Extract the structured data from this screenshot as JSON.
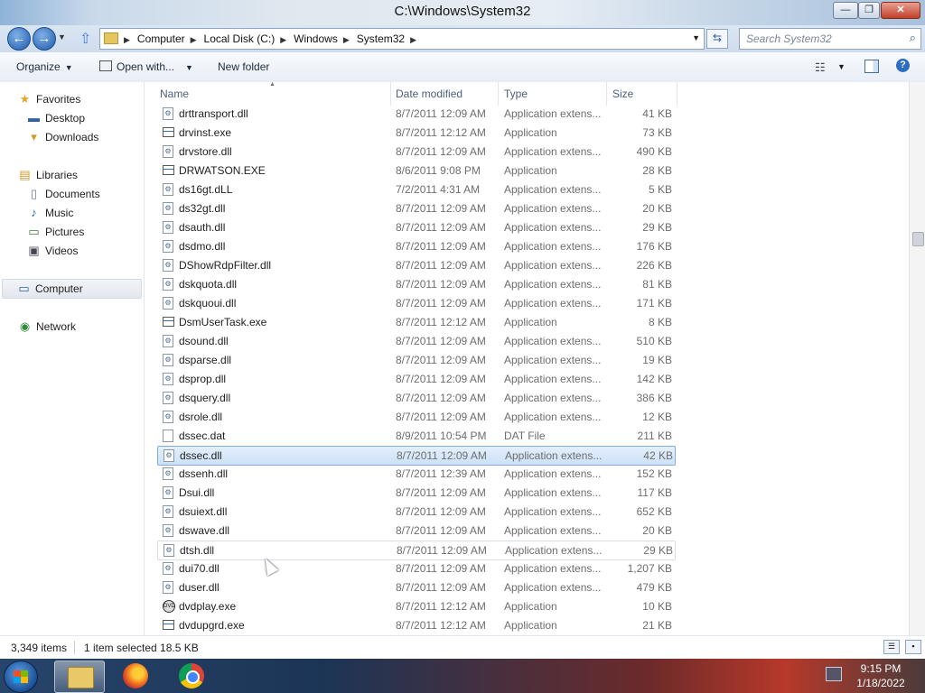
{
  "window": {
    "title": "C:\\Windows\\System32",
    "minimize_label": "—",
    "maximize_label": "❐",
    "close_label": "✕"
  },
  "address_bar": {
    "crumbs": [
      "Computer",
      "Local Disk (C:)",
      "Windows",
      "System32"
    ],
    "separator": "▶",
    "back_icon": "←",
    "forward_icon": "→",
    "refresh_icon": "⇆"
  },
  "search": {
    "placeholder": "Search System32",
    "icon": "⌕"
  },
  "commands": {
    "organize": "Organize",
    "open_with": "Open with...",
    "new_folder": "New folder",
    "caret": "▼",
    "help": "?"
  },
  "nav_pane": {
    "favorites": {
      "label": "Favorites",
      "icon": "★"
    },
    "desktop": {
      "label": "Desktop",
      "icon": "▬"
    },
    "downloads": {
      "label": "Downloads",
      "icon": "▾"
    },
    "libraries": {
      "label": "Libraries",
      "icon": "▤"
    },
    "documents": {
      "label": "Documents",
      "icon": "▯"
    },
    "music": {
      "label": "Music",
      "icon": "♪"
    },
    "pictures": {
      "label": "Pictures",
      "icon": "▭"
    },
    "videos": {
      "label": "Videos",
      "icon": "▣"
    },
    "computer": {
      "label": "Computer",
      "icon": "▭"
    },
    "network": {
      "label": "Network",
      "icon": "◉"
    }
  },
  "columns": {
    "name": "Name",
    "date": "Date modified",
    "type": "Type",
    "size": "Size",
    "sort": "▲"
  },
  "files": [
    {
      "name": "drttransport.dll",
      "date": "8/7/2011 12:09 AM",
      "type": "Application extens...",
      "size": "41 KB",
      "icon": "dll"
    },
    {
      "name": "drvinst.exe",
      "date": "8/7/2011 12:12 AM",
      "type": "Application",
      "size": "73 KB",
      "icon": "exe"
    },
    {
      "name": "drvstore.dll",
      "date": "8/7/2011 12:09 AM",
      "type": "Application extens...",
      "size": "490 KB",
      "icon": "dll"
    },
    {
      "name": "DRWATSON.EXE",
      "date": "8/6/2011 9:08 PM",
      "type": "Application",
      "size": "28 KB",
      "icon": "exe"
    },
    {
      "name": "ds16gt.dLL",
      "date": "7/2/2011 4:31 AM",
      "type": "Application extens...",
      "size": "5 KB",
      "icon": "dll"
    },
    {
      "name": "ds32gt.dll",
      "date": "8/7/2011 12:09 AM",
      "type": "Application extens...",
      "size": "20 KB",
      "icon": "dll"
    },
    {
      "name": "dsauth.dll",
      "date": "8/7/2011 12:09 AM",
      "type": "Application extens...",
      "size": "29 KB",
      "icon": "dll"
    },
    {
      "name": "dsdmo.dll",
      "date": "8/7/2011 12:09 AM",
      "type": "Application extens...",
      "size": "176 KB",
      "icon": "dll"
    },
    {
      "name": "DShowRdpFilter.dll",
      "date": "8/7/2011 12:09 AM",
      "type": "Application extens...",
      "size": "226 KB",
      "icon": "dll"
    },
    {
      "name": "dskquota.dll",
      "date": "8/7/2011 12:09 AM",
      "type": "Application extens...",
      "size": "81 KB",
      "icon": "dll"
    },
    {
      "name": "dskquoui.dll",
      "date": "8/7/2011 12:09 AM",
      "type": "Application extens...",
      "size": "171 KB",
      "icon": "dll"
    },
    {
      "name": "DsmUserTask.exe",
      "date": "8/7/2011 12:12 AM",
      "type": "Application",
      "size": "8 KB",
      "icon": "exe"
    },
    {
      "name": "dsound.dll",
      "date": "8/7/2011 12:09 AM",
      "type": "Application extens...",
      "size": "510 KB",
      "icon": "dll"
    },
    {
      "name": "dsparse.dll",
      "date": "8/7/2011 12:09 AM",
      "type": "Application extens...",
      "size": "19 KB",
      "icon": "dll"
    },
    {
      "name": "dsprop.dll",
      "date": "8/7/2011 12:09 AM",
      "type": "Application extens...",
      "size": "142 KB",
      "icon": "dll"
    },
    {
      "name": "dsquery.dll",
      "date": "8/7/2011 12:09 AM",
      "type": "Application extens...",
      "size": "386 KB",
      "icon": "dll"
    },
    {
      "name": "dsrole.dll",
      "date": "8/7/2011 12:09 AM",
      "type": "Application extens...",
      "size": "12 KB",
      "icon": "dll"
    },
    {
      "name": "dssec.dat",
      "date": "8/9/2011 10:54 PM",
      "type": "DAT File",
      "size": "211 KB",
      "icon": "dat"
    },
    {
      "name": "dssec.dll",
      "date": "8/7/2011 12:09 AM",
      "type": "Application extens...",
      "size": "42 KB",
      "icon": "dll",
      "state": "selected"
    },
    {
      "name": "dssenh.dll",
      "date": "8/7/2011 12:39 AM",
      "type": "Application extens...",
      "size": "152 KB",
      "icon": "dll"
    },
    {
      "name": "Dsui.dll",
      "date": "8/7/2011 12:09 AM",
      "type": "Application extens...",
      "size": "117 KB",
      "icon": "dll"
    },
    {
      "name": "dsuiext.dll",
      "date": "8/7/2011 12:09 AM",
      "type": "Application extens...",
      "size": "652 KB",
      "icon": "dll"
    },
    {
      "name": "dswave.dll",
      "date": "8/7/2011 12:09 AM",
      "type": "Application extens...",
      "size": "20 KB",
      "icon": "dll"
    },
    {
      "name": "dtsh.dll",
      "date": "8/7/2011 12:09 AM",
      "type": "Application extens...",
      "size": "29 KB",
      "icon": "dll",
      "state": "hovered"
    },
    {
      "name": "dui70.dll",
      "date": "8/7/2011 12:09 AM",
      "type": "Application extens...",
      "size": "1,207 KB",
      "icon": "dll"
    },
    {
      "name": "duser.dll",
      "date": "8/7/2011 12:09 AM",
      "type": "Application extens...",
      "size": "479 KB",
      "icon": "dll"
    },
    {
      "name": "dvdplay.exe",
      "date": "8/7/2011 12:12 AM",
      "type": "Application",
      "size": "10 KB",
      "icon": "dvd"
    },
    {
      "name": "dvdupgrd.exe",
      "date": "8/7/2011 12:12 AM",
      "type": "Application",
      "size": "21 KB",
      "icon": "exe"
    }
  ],
  "status": {
    "items_count": "3,349 items",
    "selection": "1 item selected  18.5 KB"
  },
  "taskbar": {
    "apps": [
      "file-explorer",
      "firefox",
      "chrome"
    ],
    "time": "9:15 PM",
    "date": "1/18/2022"
  }
}
